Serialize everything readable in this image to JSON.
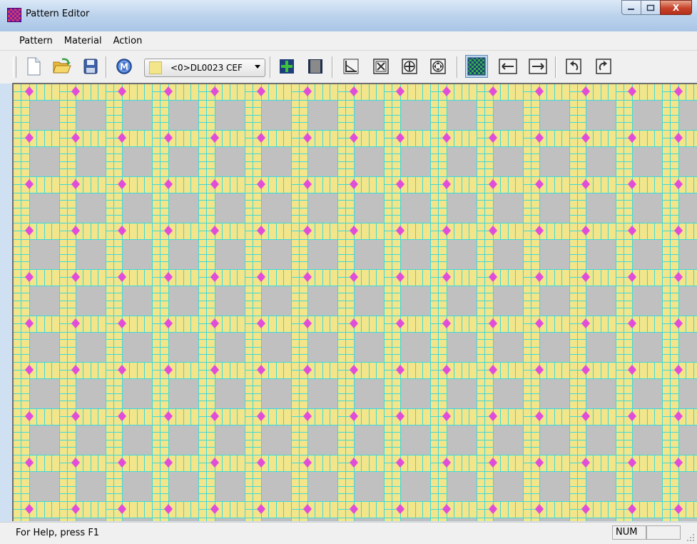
{
  "window": {
    "title": "Pattern Editor",
    "caption_buttons": {
      "minimize": "—",
      "maximize": "□",
      "close": "X"
    }
  },
  "menu": {
    "items": [
      {
        "label": "Pattern"
      },
      {
        "label": "Material"
      },
      {
        "label": "Action"
      }
    ]
  },
  "toolbar": {
    "material_combo": {
      "value": "<0>DL0023 CEF",
      "swatch_color": "#f2e58a"
    },
    "buttons": [
      {
        "name": "new-document",
        "icon": "new-document-icon"
      },
      {
        "name": "open-folder",
        "icon": "open-folder-icon"
      },
      {
        "name": "save",
        "icon": "save-disk-icon"
      },
      {
        "name": "material",
        "icon": "material-m-circle-icon",
        "label": "M"
      },
      {
        "name": "add-tile",
        "icon": "green-plus-tile-icon"
      },
      {
        "name": "remove-tile",
        "icon": "gray-tile-icon"
      },
      {
        "name": "angle",
        "icon": "angle-icon"
      },
      {
        "name": "cross-box",
        "icon": "cross-box-icon"
      },
      {
        "name": "move-cross",
        "icon": "move-cross-icon"
      },
      {
        "name": "move-arrows",
        "icon": "move-arrows-icon"
      },
      {
        "name": "checker-view",
        "icon": "checker-view-icon"
      },
      {
        "name": "arrow-left",
        "icon": "arrow-left-icon"
      },
      {
        "name": "arrow-right",
        "icon": "arrow-right-icon"
      },
      {
        "name": "rotate-ccw",
        "icon": "rotate-ccw-icon"
      },
      {
        "name": "rotate-cw",
        "icon": "rotate-cw-icon"
      }
    ]
  },
  "pattern": {
    "colors": {
      "tile": "#c0c0c0",
      "border_band": "#f2e58a",
      "grout": "#3fd9d9",
      "dot": "#e04ed9"
    }
  },
  "status": {
    "help_text": "For Help, press F1",
    "num_indicator": "NUM"
  }
}
